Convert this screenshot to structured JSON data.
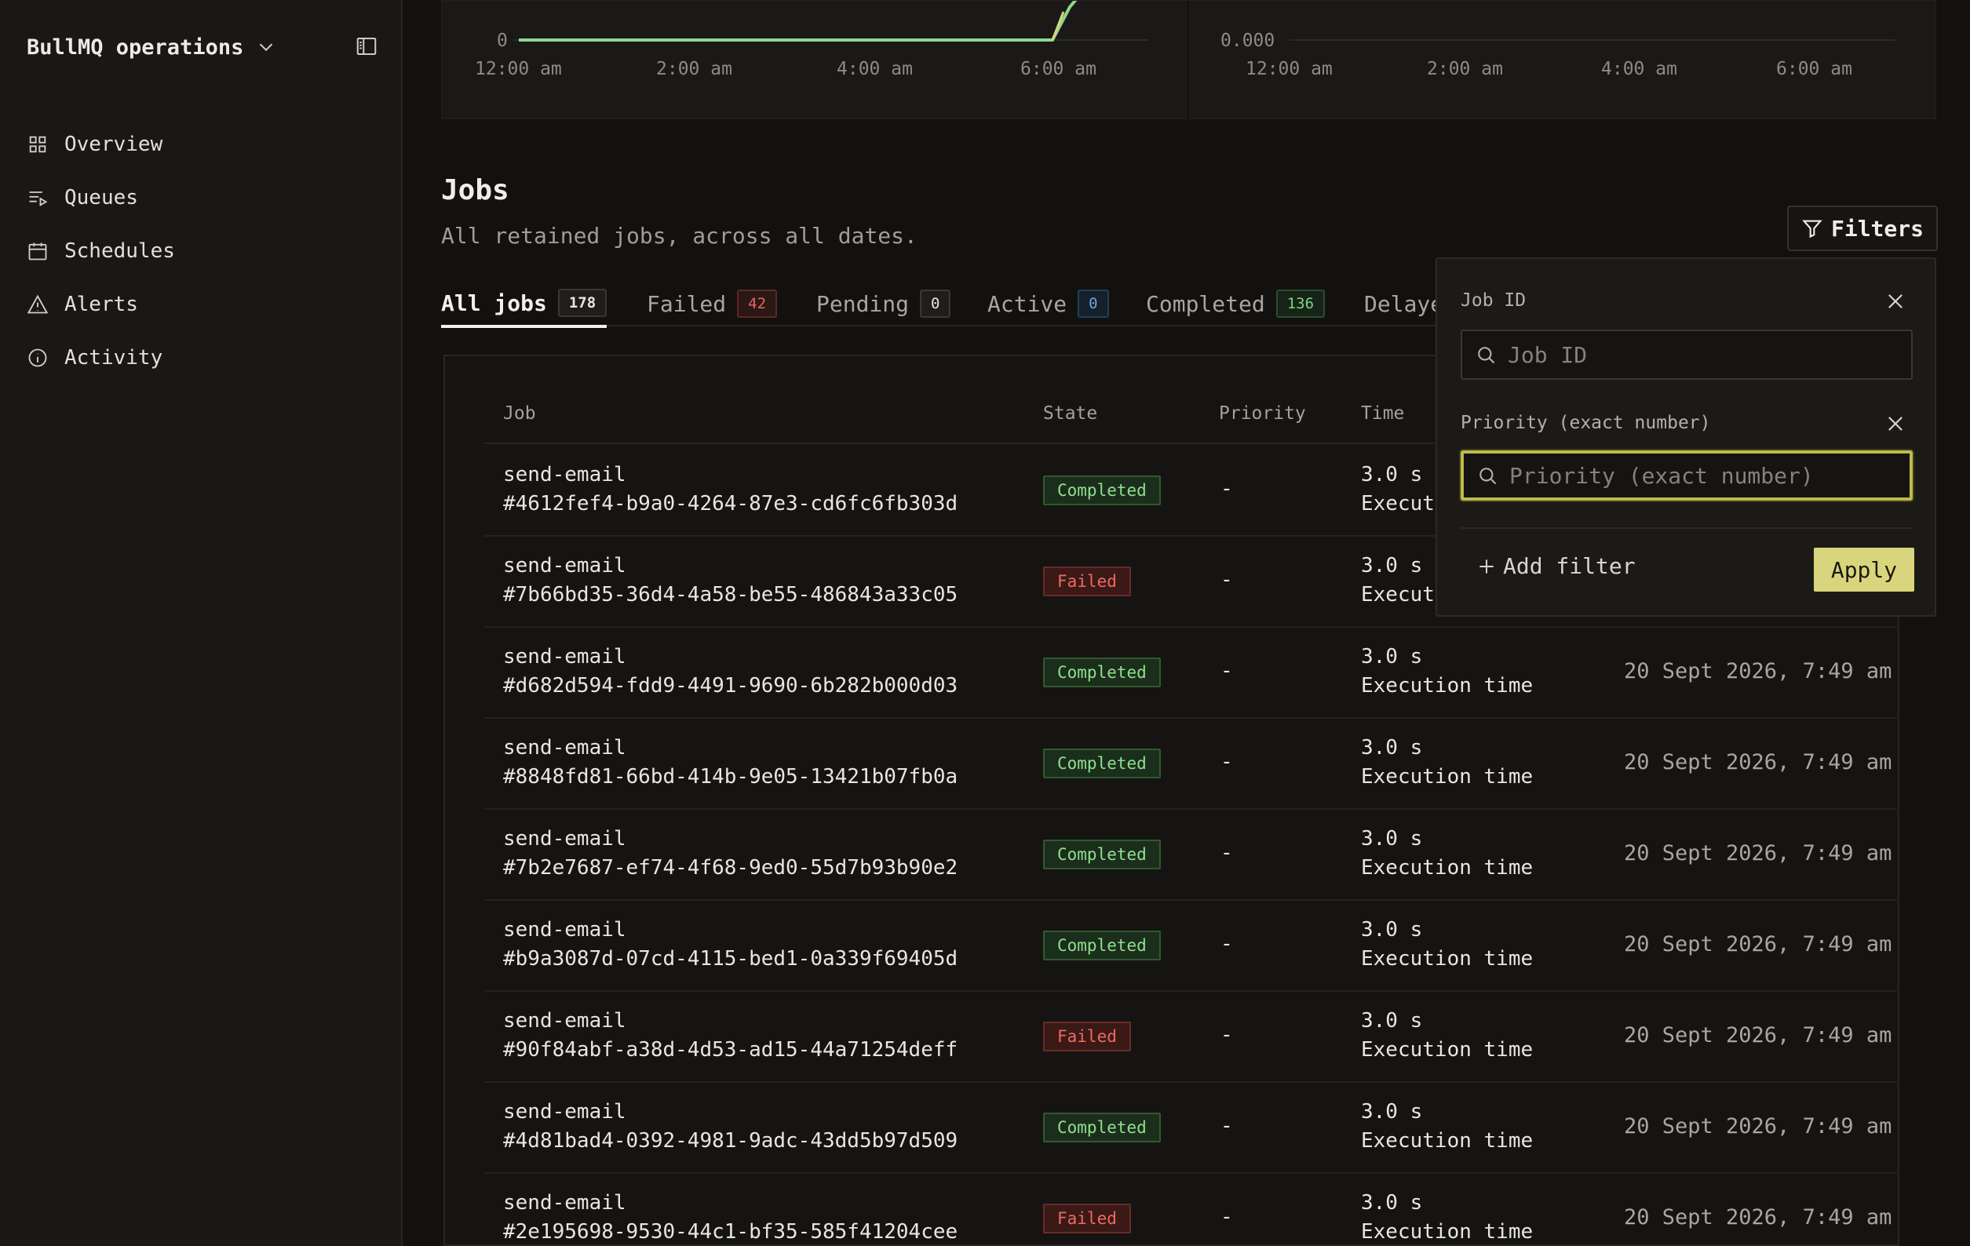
{
  "app": {
    "title": "BullMQ operations"
  },
  "sidebar": {
    "items": [
      {
        "label": "Overview",
        "icon": "grid-icon"
      },
      {
        "label": "Queues",
        "icon": "list-play-icon"
      },
      {
        "label": "Schedules",
        "icon": "calendar-icon"
      },
      {
        "label": "Alerts",
        "icon": "warning-triangle-icon"
      },
      {
        "label": "Activity",
        "icon": "info-circle-icon"
      }
    ]
  },
  "charts": {
    "left": {
      "y_tick": "0",
      "x_ticks": [
        "12:00 am",
        "2:00 am",
        "4:00 am",
        "6:00 am"
      ]
    },
    "right": {
      "y_tick": "0.000",
      "x_ticks": [
        "12:00 am",
        "2:00 am",
        "4:00 am",
        "6:00 am"
      ]
    },
    "line_color": "#8ed68e"
  },
  "jobs": {
    "title": "Jobs",
    "subtitle": "All retained jobs, across all dates.",
    "filters_label": "Filters",
    "tabs": [
      {
        "label": "All jobs",
        "count": "178"
      },
      {
        "label": "Failed",
        "count": "42"
      },
      {
        "label": "Pending",
        "count": "0"
      },
      {
        "label": "Active",
        "count": "0"
      },
      {
        "label": "Completed",
        "count": "136"
      },
      {
        "label": "Delaye"
      }
    ],
    "columns": {
      "job": "Job",
      "state": "State",
      "priority": "Priority",
      "time": "Time"
    },
    "rows": [
      {
        "name": "send-email",
        "id": "#4612fef4-b9a0-4264-87e3-cd6fc6fb303d",
        "state": "Completed",
        "priority": "-",
        "time": "3.0 s",
        "time_label": "Executi",
        "date": ""
      },
      {
        "name": "send-email",
        "id": "#7b66bd35-36d4-4a58-be55-486843a33c05",
        "state": "Failed",
        "priority": "-",
        "time": "3.0 s",
        "time_label": "Executi",
        "date": ""
      },
      {
        "name": "send-email",
        "id": "#d682d594-fdd9-4491-9690-6b282b000d03",
        "state": "Completed",
        "priority": "-",
        "time": "3.0 s",
        "time_label": "Execution time",
        "date": "20 Sept 2026, 7:49 am"
      },
      {
        "name": "send-email",
        "id": "#8848fd81-66bd-414b-9e05-13421b07fb0a",
        "state": "Completed",
        "priority": "-",
        "time": "3.0 s",
        "time_label": "Execution time",
        "date": "20 Sept 2026, 7:49 am"
      },
      {
        "name": "send-email",
        "id": "#7b2e7687-ef74-4f68-9ed0-55d7b93b90e2",
        "state": "Completed",
        "priority": "-",
        "time": "3.0 s",
        "time_label": "Execution time",
        "date": "20 Sept 2026, 7:49 am"
      },
      {
        "name": "send-email",
        "id": "#b9a3087d-07cd-4115-bed1-0a339f69405d",
        "state": "Completed",
        "priority": "-",
        "time": "3.0 s",
        "time_label": "Execution time",
        "date": "20 Sept 2026, 7:49 am"
      },
      {
        "name": "send-email",
        "id": "#90f84abf-a38d-4d53-ad15-44a71254deff",
        "state": "Failed",
        "priority": "-",
        "time": "3.0 s",
        "time_label": "Execution time",
        "date": "20 Sept 2026, 7:49 am"
      },
      {
        "name": "send-email",
        "id": "#4d81bad4-0392-4981-9adc-43dd5b97d509",
        "state": "Completed",
        "priority": "-",
        "time": "3.0 s",
        "time_label": "Execution time",
        "date": "20 Sept 2026, 7:49 am"
      },
      {
        "name": "send-email",
        "id": "#2e195698-9530-44c1-bf35-585f41204cee",
        "state": "Failed",
        "priority": "-",
        "time": "3.0 s",
        "time_label": "Execution time",
        "date": "20 Sept 2026, 7:49 am"
      }
    ]
  },
  "filter_panel": {
    "job_id_label": "Job ID",
    "job_id_placeholder": "Job ID",
    "priority_label": "Priority (exact number)",
    "priority_placeholder": "Priority (exact number)",
    "add_filter_label": "Add filter",
    "apply_label": "Apply",
    "accent": "#d9d57c"
  }
}
